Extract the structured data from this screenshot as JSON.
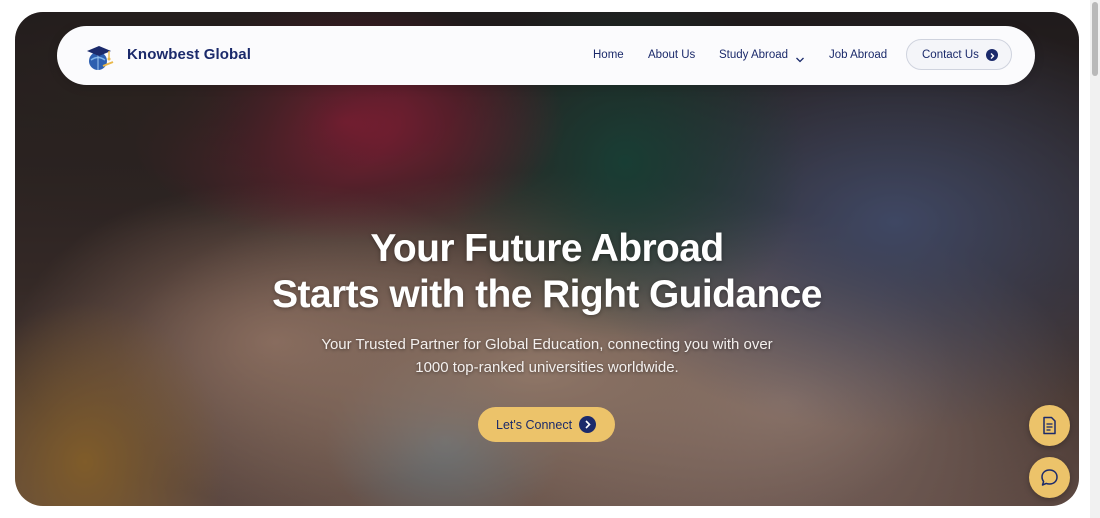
{
  "brand": {
    "name": "Knowbest Global",
    "logo_icon": "graduation-globe-icon"
  },
  "nav": {
    "items": [
      {
        "label": "Home"
      },
      {
        "label": "About Us"
      },
      {
        "label": "Study Abroad",
        "has_dropdown": true
      },
      {
        "label": "Job Abroad"
      }
    ],
    "contact_label": "Contact Us",
    "contact_icon": "arrow-right-circle-icon"
  },
  "hero": {
    "headline_line1": "Your Future Abroad",
    "headline_line2": "Starts with the Right Guidance",
    "subtitle_line1": "Your Trusted Partner for Global Education, connecting you with over",
    "subtitle_line2": "1000 top-ranked universities worldwide.",
    "cta_label": "Let's Connect",
    "cta_icon": "arrow-right-circle-icon"
  },
  "floating_actions": [
    {
      "icon": "document-icon"
    },
    {
      "icon": "chat-bubble-icon"
    }
  ],
  "colors": {
    "navy": "#1b2a6b",
    "gold": "#ecc36a",
    "nav_bg": "#fbfbfd"
  }
}
